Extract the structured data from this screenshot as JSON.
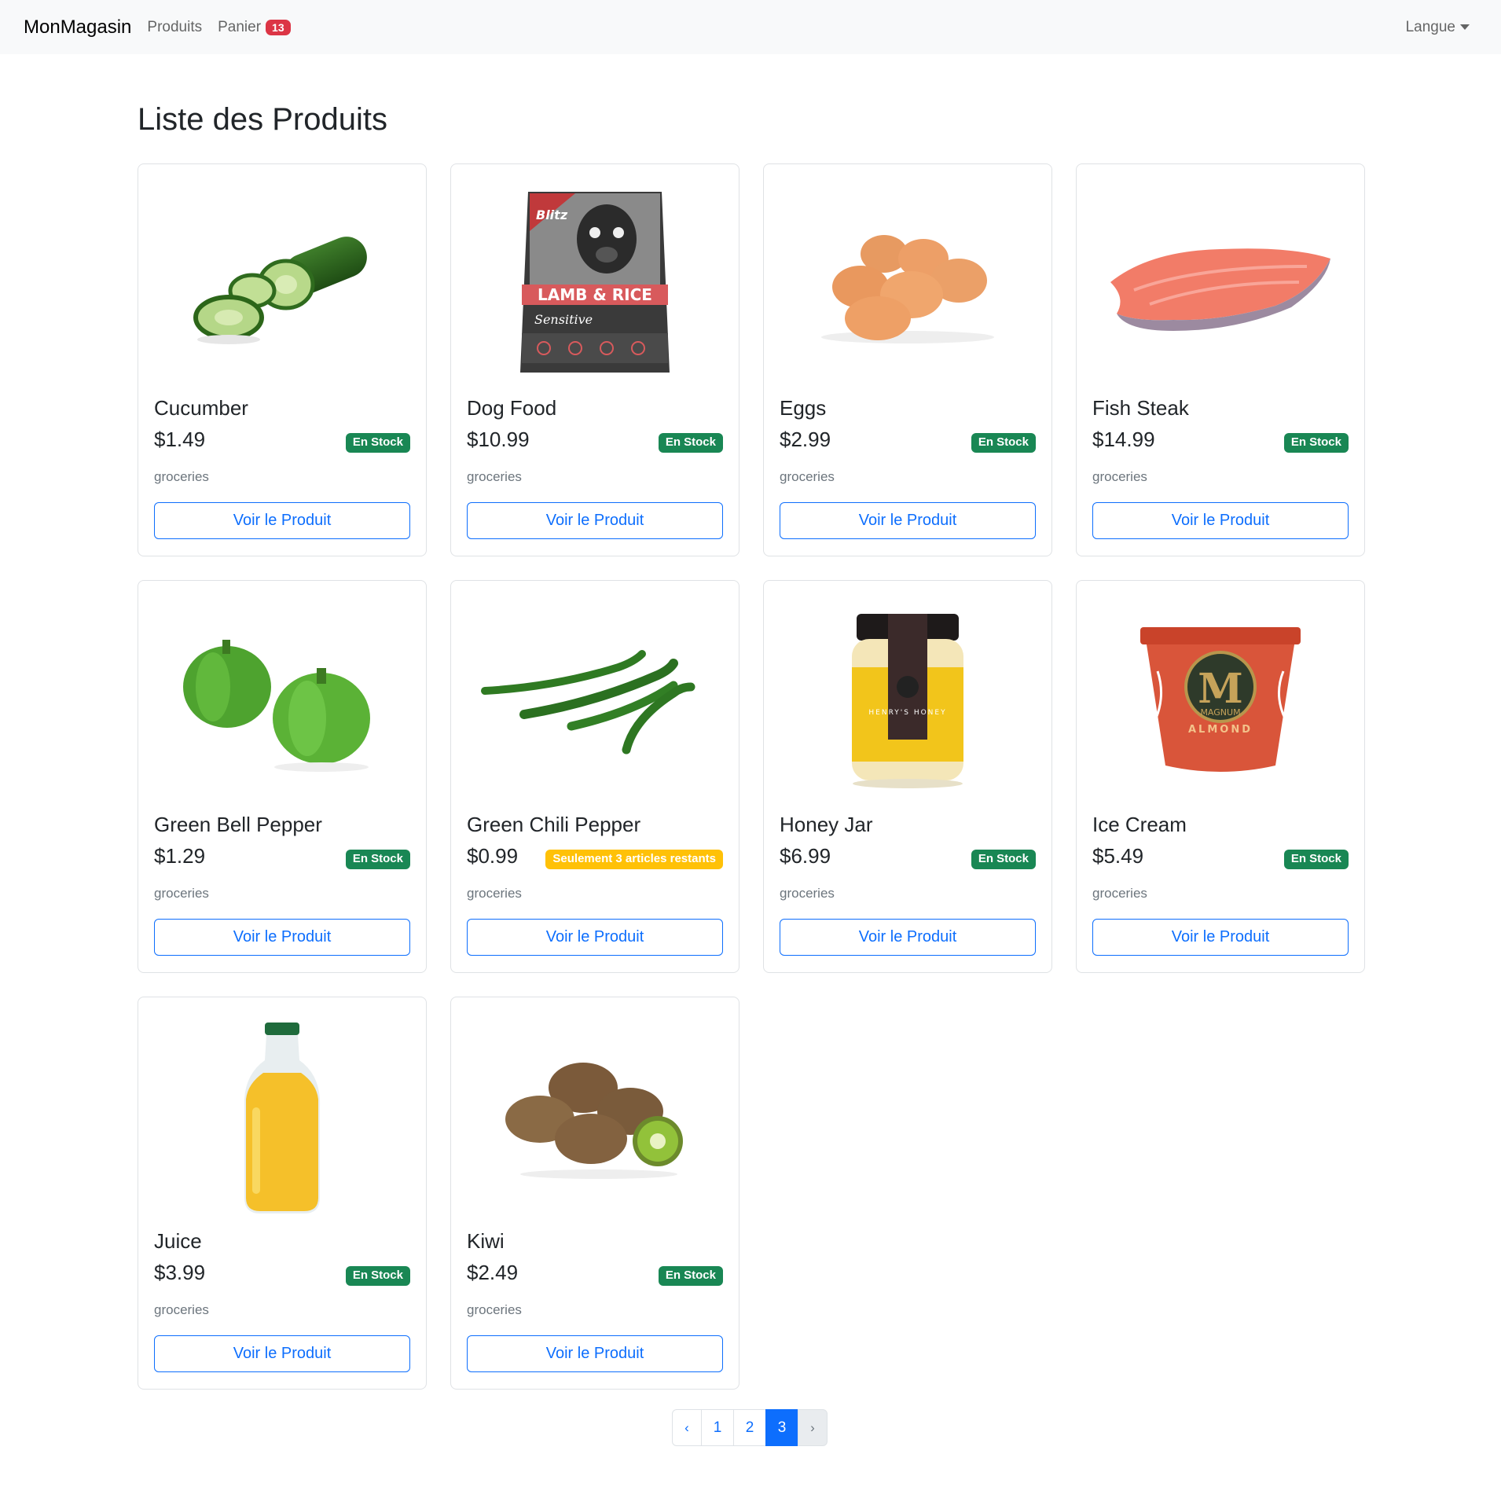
{
  "navbar": {
    "brand": "MonMagasin",
    "products_label": "Produits",
    "cart_label": "Panier",
    "cart_count": "13",
    "language_label": "Langue"
  },
  "page_title": "Liste des Produits",
  "products": [
    {
      "name": "Cucumber",
      "price": "$1.49",
      "stock": "En Stock",
      "stock_level": "in-stock",
      "category": "groceries",
      "button": "Voir le Produit",
      "image": "cucumber"
    },
    {
      "name": "Dog Food",
      "price": "$10.99",
      "stock": "En Stock",
      "stock_level": "in-stock",
      "category": "groceries",
      "button": "Voir le Produit",
      "image": "dog-food-bag"
    },
    {
      "name": "Eggs",
      "price": "$2.99",
      "stock": "En Stock",
      "stock_level": "in-stock",
      "category": "groceries",
      "button": "Voir le Produit",
      "image": "eggs"
    },
    {
      "name": "Fish Steak",
      "price": "$14.99",
      "stock": "En Stock",
      "stock_level": "in-stock",
      "category": "groceries",
      "button": "Voir le Produit",
      "image": "fish-steak"
    },
    {
      "name": "Green Bell Pepper",
      "price": "$1.29",
      "stock": "En Stock",
      "stock_level": "in-stock",
      "category": "groceries",
      "button": "Voir le Produit",
      "image": "green-bell-pepper"
    },
    {
      "name": "Green Chili Pepper",
      "price": "$0.99",
      "stock": "Seulement 3 articles restants",
      "stock_level": "low-stock",
      "category": "groceries",
      "button": "Voir le Produit",
      "image": "green-chili-pepper"
    },
    {
      "name": "Honey Jar",
      "price": "$6.99",
      "stock": "En Stock",
      "stock_level": "in-stock",
      "category": "groceries",
      "button": "Voir le Produit",
      "image": "honey-jar"
    },
    {
      "name": "Ice Cream",
      "price": "$5.49",
      "stock": "En Stock",
      "stock_level": "in-stock",
      "category": "groceries",
      "button": "Voir le Produit",
      "image": "ice-cream-tub"
    },
    {
      "name": "Juice",
      "price": "$3.99",
      "stock": "En Stock",
      "stock_level": "in-stock",
      "category": "groceries",
      "button": "Voir le Produit",
      "image": "juice-bottle"
    },
    {
      "name": "Kiwi",
      "price": "$2.49",
      "stock": "En Stock",
      "stock_level": "in-stock",
      "category": "groceries",
      "button": "Voir le Produit",
      "image": "kiwi"
    }
  ],
  "pagination": {
    "prev": "‹",
    "pages": [
      "1",
      "2",
      "3"
    ],
    "current": "3",
    "next": "›"
  },
  "colors": {
    "primary": "#0d6efd",
    "success": "#198754",
    "warning": "#ffc107",
    "danger": "#dc3545",
    "navbar_bg": "#f8f9fa"
  },
  "image_text": {
    "dog_food_brand": "Blitz",
    "dog_food_line": "LAMB & RICE",
    "dog_food_sub": "Sensitive",
    "honey_brand": "HENRY'S HONEY",
    "ice_cream_brand": "MAGNUM",
    "ice_cream_flavor": "ALMOND"
  }
}
